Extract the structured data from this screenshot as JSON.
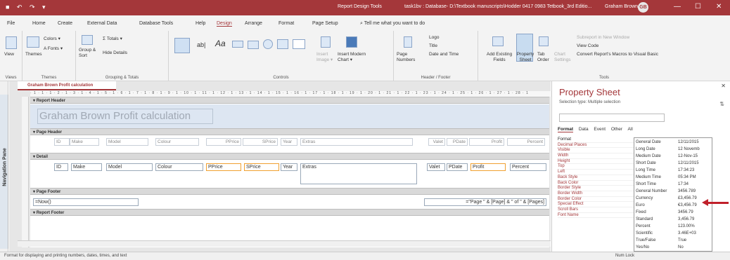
{
  "titlebar": {
    "qat": "■ ↶ ↷ ▾",
    "context": "Report Design Tools",
    "document": "task1bv : Database- D:\\Textbook manuscripts\\Hodder 0417 0983 Tetbook_3rd Editio...",
    "user": "Graham Brown",
    "initials": "GB",
    "min": "—",
    "max": "☐",
    "close": "✕"
  },
  "tabs": [
    "File",
    "Home",
    "Create",
    "External Data",
    "Database Tools",
    "Help",
    "Design",
    "Arrange",
    "Format",
    "Page Setup",
    "⌕ Tell me what you want to do"
  ],
  "ribbon": {
    "views": {
      "label": "View",
      "group": "Views"
    },
    "themes": {
      "themes": "Themes",
      "colors": "Colors ▾",
      "fonts": "A Fonts ▾",
      "group": "Themes"
    },
    "grouping": {
      "group_sort": "Group & Sort",
      "totals": "Σ Totals ▾",
      "hide": "Hide Details",
      "group": "Grouping & Totals"
    },
    "controls": {
      "ab": "ab|",
      "aa": "Aa",
      "insert_image": "Insert Image ▾",
      "insert_chart": "Insert Modern Chart ▾",
      "group": "Controls"
    },
    "header": {
      "page_numbers": "Page Numbers",
      "logo": "Logo",
      "title": "Title",
      "date_time": "Date and Time",
      "group": "Header / Footer"
    },
    "tools": {
      "add_fields": "Add Existing Fields",
      "prop_sheet": "Property Sheet",
      "tab_order": "Tab Order",
      "chart_settings": "Chart Settings",
      "subreport": "Subreport in New Window",
      "view_code": "View Code",
      "convert": "Convert Report's Macros to Visual Basic",
      "group": "Tools"
    }
  },
  "nav_pane": "Navigation Pane",
  "doc_tab": "Graham Brown Profit calculation",
  "ruler": "· 1 · 1 · 1 · 2 · 1 · 3 · 1 · 4 · 1 · 5 · 1 · 6 · 1 · 7 · 1 · 8 · 1 · 9 · 1 · 10 · 1 · 11 · 1 · 12 · 1 · 13 · 1 · 14 · 1 · 15 · 1 · 16 · 1 · 17 · 1 · 18 · 1 · 19 · 1 · 20 · 1 · 21 · 1 · 22 · 1 · 23 · 1 · 24 · 1 · 25 · 1 · 26 · 1 · 27 · 1 · 28 · 1",
  "sections": {
    "report_header": "Report Header",
    "page_header": "Page Header",
    "detail": "Detail",
    "page_footer": "Page Footer",
    "report_footer": "Report Footer"
  },
  "report_title": "Graham Brown Profit calculation",
  "header_labels": [
    "ID",
    "Make",
    "Model",
    "Colour",
    "PPrice",
    "SPrice",
    "Year",
    "Extras",
    "Valet",
    "PDate",
    "Profit",
    "Percent"
  ],
  "detail_fields": [
    "ID",
    "Make",
    "Model",
    "Colour",
    "PPrice",
    "SPrice",
    "Year",
    "Extras",
    "Valet",
    "PDate",
    "Profit",
    "Percent"
  ],
  "footer": {
    "now": "=Now()",
    "page": "=\"Page \" & [Page] & \" of \" & [Pages]"
  },
  "property_sheet": {
    "title": "Property Sheet",
    "selection": "Selection type:  Multiple selection",
    "close": "✕",
    "sort": "⇅",
    "tabs": [
      "Format",
      "Data",
      "Event",
      "Other",
      "All"
    ],
    "properties": [
      "Format",
      "Decimal Places",
      "Visible",
      "Width",
      "Height",
      "Top",
      "Left",
      "Back Style",
      "Back Color",
      "Border Style",
      "Border Width",
      "Border Color",
      "Special Effect",
      "Scroll Bars",
      "Font Name"
    ],
    "formats": [
      [
        "General Date",
        "12/11/2015"
      ],
      [
        "Long Date",
        "12 Novemb"
      ],
      [
        "Medium Date",
        "12-Nov-15"
      ],
      [
        "Short Date",
        "12/11/2015"
      ],
      [
        "Long Time",
        "17:34:23"
      ],
      [
        "Medium Time",
        "05:34 PM"
      ],
      [
        "Short Time",
        "17:34"
      ],
      [
        "General Number",
        "3456.789"
      ],
      [
        "Currency",
        "£3,456.79"
      ],
      [
        "Euro",
        "€3,456.79"
      ],
      [
        "Fixed",
        "3456.79"
      ],
      [
        "Standard",
        "3,456.79"
      ],
      [
        "Percent",
        "123.00%"
      ],
      [
        "Scientific",
        "3.46E+03"
      ],
      [
        "True/False",
        "True"
      ],
      [
        "Yes/No",
        "No"
      ]
    ]
  },
  "status": {
    "left": "Format for displaying and printing numbers, dates, times, and text",
    "right": "Num Lock"
  }
}
